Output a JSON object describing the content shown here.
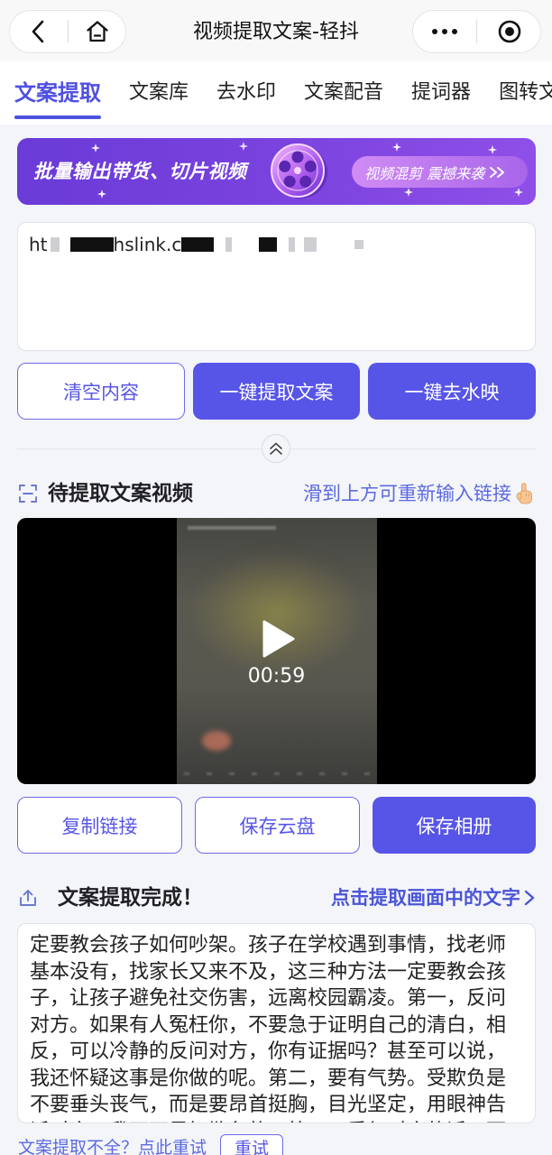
{
  "header": {
    "title": "视频提取文案-轻抖"
  },
  "tabs": [
    {
      "label": "文案提取",
      "active": true
    },
    {
      "label": "文案库",
      "active": false
    },
    {
      "label": "去水印",
      "active": false
    },
    {
      "label": "文案配音",
      "active": false
    },
    {
      "label": "提词器",
      "active": false
    },
    {
      "label": "图转文",
      "active": false
    }
  ],
  "banner": {
    "headline": "批量输出带货、切片视频",
    "cta": "视频混剪 震撼来袭"
  },
  "link_input": {
    "prefix": "ht",
    "fragment": "hslink.c"
  },
  "link_actions": {
    "clear": "清空内容",
    "extract": "一键提取文案",
    "remove_watermark": "一键去水映"
  },
  "video_section": {
    "title": "待提取文案视频",
    "hint": "滑到上方可重新输入链接",
    "duration": "00:59"
  },
  "video_actions": {
    "copy_link": "复制链接",
    "save_cloud": "保存云盘",
    "save_album": "保存相册"
  },
  "result_section": {
    "title": "文案提取完成！",
    "ocr_link": "点击提取画面中的文字",
    "text": "定要教会孩子如何吵架。孩子在学校遇到事情，找老师基本没有，找家长又来不及，这三种方法一定要教会孩子，让孩子避免社交伤害，远离校园霸凌。第一，反问对方。如果有人冤枉你，不要急于证明自己的清白，相反，可以冷静的反问对方，你有证据吗？甚至可以说，我还怀疑这事是你做的呢。第二，要有气势。受欺负是不要垂头丧气，而是要昂首挺胸，目光坚定，用眼神告诉对方，我可不是好欺负的。第三，重复对方的话，面"
  },
  "retry": {
    "hint": "文案提取不全？点此重试",
    "button": "重试"
  },
  "icons": {
    "back": "chevron-left-icon",
    "home": "home-icon",
    "more": "more-dots-icon",
    "close": "target-circle-icon",
    "banner_reel": "film-reel-icon",
    "banner_arrow": "double-chevron-right-icon",
    "collapse": "double-chevron-up-icon",
    "video_section": "scan-frame-icon",
    "hint_hand": "pointing-up-hand-icon",
    "play": "play-icon",
    "result_section": "upload-icon",
    "ocr_link": "chevron-right-icon"
  },
  "colors": {
    "primary": "#5755e7",
    "tab_active": "#4f50e2",
    "link": "#5b6ae0",
    "page_bg": "#f4f5f9",
    "banner_start": "#6a3bd7",
    "banner_end": "#8f4fe8",
    "pill_start": "#d08cf4",
    "pill_end": "#a865ea"
  }
}
